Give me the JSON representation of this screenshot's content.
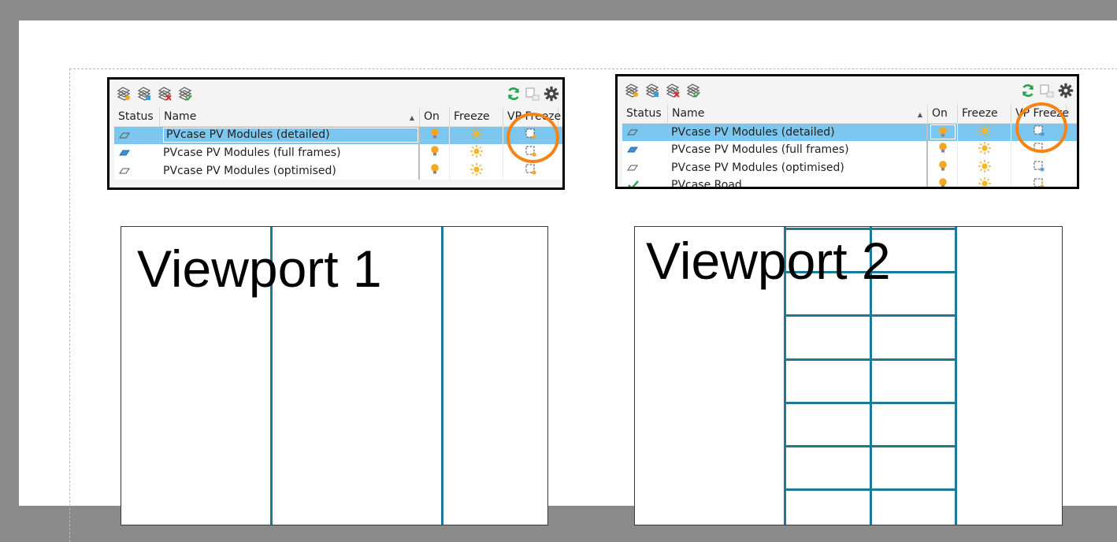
{
  "colors": {
    "background": "#8a8a8a",
    "sheet": "#ffffff",
    "selected_row": "#7cc7ef",
    "highlight_ring": "#f48418",
    "module_lines": "#1d7a96"
  },
  "panels": [
    {
      "columns": [
        "Status",
        "Name",
        "On",
        "Freeze",
        "VP Freeze"
      ],
      "toolbar_icons": [
        "new-layer-icon",
        "new-vp-frozen-layer-icon",
        "delete-layer-icon",
        "set-current-layer-icon",
        "refresh-icon",
        "layer-states-icon",
        "settings-gear-icon"
      ],
      "rows": [
        {
          "status_icon": "layer-outline-icon",
          "name": "PVcase PV Modules (detailed)",
          "selected": true,
          "vp_freeze_state": "thawed"
        },
        {
          "status_icon": "layer-filled-icon",
          "name": "PVcase PV Modules (full frames)",
          "selected": false,
          "vp_freeze_state": "thawed"
        },
        {
          "status_icon": "layer-outline-icon",
          "name": "PVcase PV Modules (optimised)",
          "selected": false,
          "vp_freeze_state": "thawed"
        }
      ]
    },
    {
      "columns": [
        "Status",
        "Name",
        "On",
        "Freeze",
        "VP Freeze"
      ],
      "toolbar_icons": [
        "new-layer-icon",
        "new-vp-frozen-layer-icon",
        "delete-layer-icon",
        "set-current-layer-icon",
        "refresh-icon",
        "layer-states-icon",
        "settings-gear-icon"
      ],
      "rows": [
        {
          "status_icon": "layer-outline-icon",
          "name": "PVcase PV Modules (detailed)",
          "selected": true,
          "vp_freeze_state": "frozen"
        },
        {
          "status_icon": "layer-filled-icon",
          "name": "PVcase PV Modules (full frames)",
          "selected": false,
          "vp_freeze_state": "thawed"
        },
        {
          "status_icon": "layer-outline-icon",
          "name": "PVcase PV Modules (optimised)",
          "selected": false,
          "vp_freeze_state": "frozen"
        },
        {
          "status_icon": "current-layer-check-icon",
          "name": "PVcase Road",
          "selected": false,
          "vp_freeze_state": "thawed"
        }
      ]
    }
  ],
  "viewports": [
    {
      "title": "Viewport 1",
      "content": "module frame lines"
    },
    {
      "title": "Viewport 2",
      "content": "detailed module grid"
    }
  ]
}
